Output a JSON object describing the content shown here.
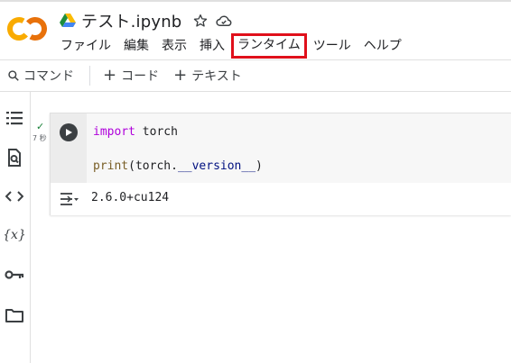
{
  "app": {
    "logo_text": "CO",
    "notebook_title": "テスト.ipynb"
  },
  "menu": [
    "ファイル",
    "編集",
    "表示",
    "挿入",
    "ランタイム",
    "ツール",
    "ヘルプ"
  ],
  "toolbar": {
    "command_label": "コマンド",
    "add_code_label": "コード",
    "add_text_label": "テキスト"
  },
  "rail": {
    "variables_label": "{x}"
  },
  "cell": {
    "exec_check": "✓",
    "exec_time": "7 秒",
    "code_line1_kw": "import",
    "code_line1_rest": " torch",
    "code_line2_fn": "print",
    "code_line2_a": "(torch.",
    "code_line2_attr": "__version__",
    "code_line2_b": ")",
    "output": "2.6.0+cu124"
  },
  "colors": {
    "highlight_box": "#e0101b",
    "keyword": "#af00db",
    "function": "#795e26",
    "attribute": "#001080",
    "logo_orange": "#f9ab00",
    "logo_deep": "#e8710a"
  }
}
